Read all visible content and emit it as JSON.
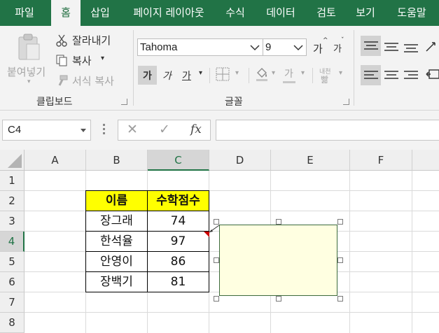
{
  "tabs": [
    "파일",
    "홈",
    "삽입",
    "페이지 레이아웃",
    "수식",
    "데이터",
    "검토",
    "보기",
    "도움말"
  ],
  "active_tab": "홈",
  "clipboard": {
    "paste": "붙여넣기",
    "cut": "잘라내기",
    "copy": "복사",
    "format_painter": "서식 복사",
    "group_label": "클립보드"
  },
  "font": {
    "name": "Tahoma",
    "size": "9",
    "grow": "가",
    "shrink": "가",
    "bold": "가",
    "italic": "가",
    "underline": "가",
    "font_color": "가",
    "phonetic": "내천",
    "group_label": "글꼴"
  },
  "formula_bar": {
    "name_box": "C4",
    "cancel_icon": "✕",
    "enter_icon": "✓",
    "fx": "fx",
    "value": ""
  },
  "grid": {
    "columns": [
      "A",
      "B",
      "C",
      "D",
      "E",
      "F"
    ],
    "rows": [
      "1",
      "2",
      "3",
      "4",
      "5",
      "6",
      "7",
      "8"
    ],
    "selected_cell": "C4",
    "table": {
      "header": [
        "이름",
        "수학점수"
      ],
      "rows": [
        [
          "장그래",
          "74"
        ],
        [
          "한석율",
          "97"
        ],
        [
          "안영이",
          "86"
        ],
        [
          "장백기",
          "81"
        ]
      ]
    }
  },
  "colors": {
    "brand": "#217346",
    "header_fill": "#ffff00",
    "comment_fill": "#ffffe1",
    "comment_indicator": "#cc0000"
  },
  "icons": {
    "paste": "clipboard-icon",
    "cut": "scissors-icon",
    "copy": "copy-icon",
    "format_painter": "paintbrush-icon",
    "borders": "border-icon",
    "fill_color": "paint-bucket-icon",
    "align": "align-icon"
  }
}
